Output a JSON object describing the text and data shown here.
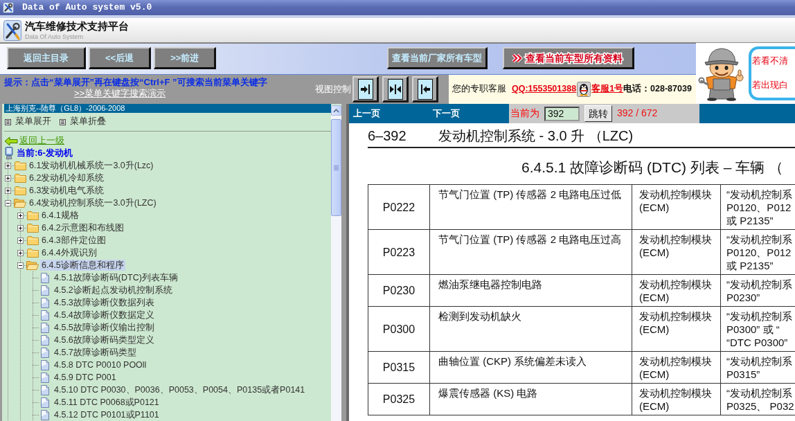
{
  "window": {
    "title": "Data of Auto system v5.0"
  },
  "header": {
    "title": "汽车维修技术支持平台",
    "subtitle": "Data Of Auto System"
  },
  "toolbar": {
    "nav_buttons": [
      "返回主目录",
      "<<后退",
      ">>前进"
    ],
    "model_buttons": [
      {
        "label": "查看当前厂家所有车型",
        "kind": "plain"
      },
      {
        "label": "查看当前车型所有资料",
        "kind": "highlight"
      }
    ]
  },
  "hint": {
    "text": "提示：点击“菜单展开”再在键盘按“Ctrl+F ”可搜索当前菜单关键字",
    "link": ">>菜单关键字搜索演示"
  },
  "view_control": {
    "label": "视图控制",
    "buttons": [
      {
        "kind": "arrow-right"
      },
      {
        "kind": "arrows-in"
      },
      {
        "kind": "arrow-left"
      }
    ]
  },
  "support": {
    "label": "您的专职客服",
    "qq": "QQ:1553501388",
    "agent": "客服1号",
    "phone": "电话：028-87039"
  },
  "notice": {
    "lines": [
      "若看不清",
      "若出现白"
    ]
  },
  "sidebar": {
    "model": "上海别克--陆尊（GL8）-2006-2008",
    "menu_actions": [
      "菜单展开",
      "菜单折叠"
    ],
    "back_link": "返回上一级",
    "current": "当前:6-发动机",
    "tree": [
      {
        "label": "6.1发动机机械系统一3.0升(Lzc)",
        "kind": "folder",
        "expanded": false,
        "selected": false
      },
      {
        "label": "6.2发动机冷却系统",
        "kind": "folder",
        "expanded": false,
        "selected": false
      },
      {
        "label": "6.3发动机电气系统",
        "kind": "folder",
        "expanded": false,
        "selected": false
      },
      {
        "label": "6.4发动机控制系统一3.0升(LZC)",
        "kind": "folder",
        "expanded": true,
        "selected": false,
        "children": [
          {
            "label": "6.4.1规格",
            "kind": "folder",
            "expanded": false,
            "selected": false
          },
          {
            "label": "6.4.2示意图和布线图",
            "kind": "folder",
            "expanded": false,
            "selected": false
          },
          {
            "label": "6.4.3部件定位图",
            "kind": "folder",
            "expanded": false,
            "selected": false
          },
          {
            "label": "6.4.4外观识别",
            "kind": "folder",
            "expanded": false,
            "selected": false
          },
          {
            "label": "6.4.5诊断信息和程序",
            "kind": "folder",
            "expanded": true,
            "selected": true,
            "children": [
              {
                "label": "4.5.1故障诊断码(DTC)列表车辆",
                "kind": "document",
                "selected": false
              },
              {
                "label": "4.5.2诊断起点发动机控制系统",
                "kind": "document",
                "selected": false
              },
              {
                "label": "4.5.3故障诊断仪数据列表",
                "kind": "document",
                "selected": false
              },
              {
                "label": "4.5.4故障诊断仪数据定义",
                "kind": "document",
                "selected": false
              },
              {
                "label": "4.5.5故障诊断仪输出控制",
                "kind": "document",
                "selected": false
              },
              {
                "label": "4.5.6故障诊断码类型定义",
                "kind": "document",
                "selected": false
              },
              {
                "label": "4.5.7故障诊断码类型",
                "kind": "document",
                "selected": false
              },
              {
                "label": "4.5.8 DTC P0010 POOll",
                "kind": "document",
                "selected": false
              },
              {
                "label": "4.5.9 DTC P001",
                "kind": "document",
                "selected": false
              },
              {
                "label": "4.5.10 DTC P0030、P0036、P0053、P0054、P0135或者P0141",
                "kind": "document",
                "selected": false
              },
              {
                "label": "4.5.11 DTC P0068或P0121",
                "kind": "document",
                "selected": false
              },
              {
                "label": "4.5.12 DTC P0101或P1101",
                "kind": "document",
                "selected": false
              }
            ]
          }
        ]
      }
    ]
  },
  "pager": {
    "prev": "上一页",
    "next": "下一页",
    "current_label": "当前为",
    "page_value": "392",
    "go_button": "跳转",
    "page_count": "392 / 672"
  },
  "document": {
    "page_number": "6–392",
    "section_title": "发动机控制系统 - 3.0 升 （LZC)",
    "heading": "6.4.5.1 故障诊断码 (DTC) 列表 – 车辆 （",
    "table": {
      "rows": [
        {
          "cells": [
            "P0222",
            "节气门位置 (TP) 传感器 2 电路电压过低",
            "发动机控制模块 (ECM)",
            "“发动机控制系\nP0120、P012\n或 P2135”"
          ]
        },
        {
          "cells": [
            "P0223",
            "节气门位置 (TP) 传感器 2 电路电压过高",
            "发动机控制模块 (ECM)",
            "“发动机控制系\nP0120、P012\n或 P2135”"
          ]
        },
        {
          "cells": [
            "P0230",
            "燃油泵继电器控制电路",
            "发动机控制模块 (ECM)",
            "“发动机控制系\nP0230”"
          ]
        },
        {
          "cells": [
            "P0300",
            "检测到发动机缺火",
            "发动机控制模块 (ECM)",
            "“发动机控制系\nP0300” 或 “\n“DTC P0300”"
          ]
        },
        {
          "cells": [
            "P0315",
            "曲轴位置 (CKP) 系统偏差未读入",
            "发动机控制模块 (ECM)",
            "“发动机控制系\nP0315”"
          ]
        },
        {
          "cells": [
            "P0325",
            "爆震传感器 (KS) 电路",
            "发动机控制模块 (ECM)",
            "“发动机控制系\nP0325、 P032"
          ]
        }
      ]
    }
  }
}
